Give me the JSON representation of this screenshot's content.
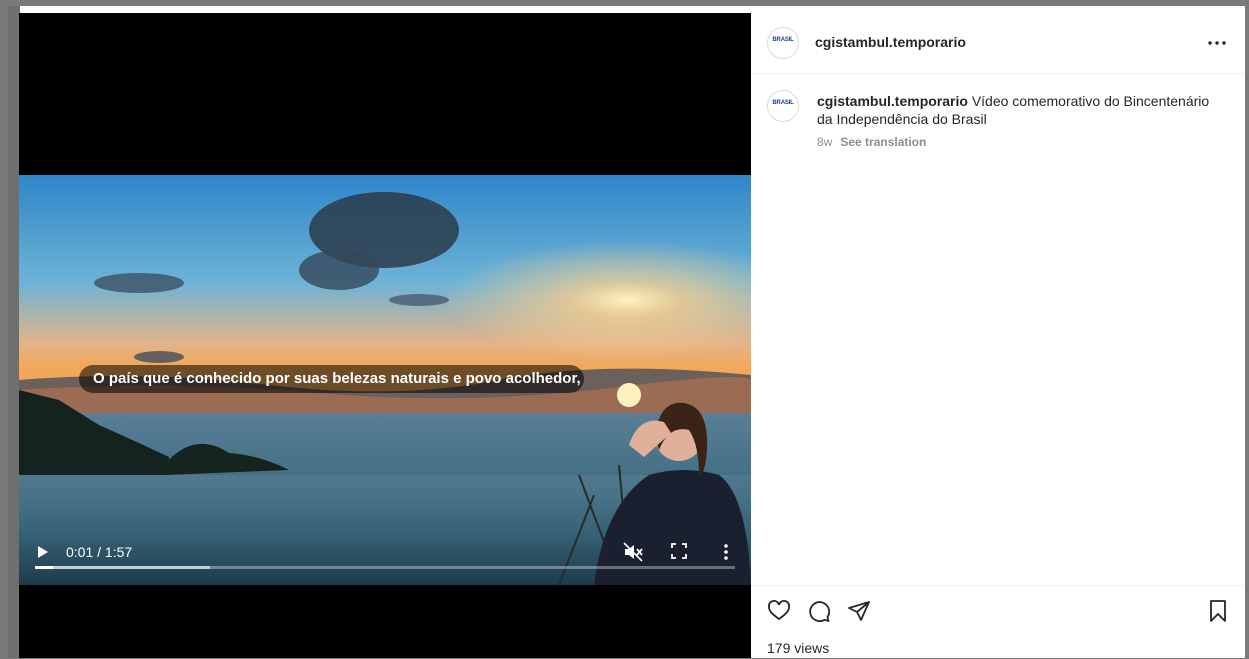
{
  "video": {
    "subtitle": "O país que é conhecido por suas belezas naturais e povo acolhedor,",
    "time": "0:01 / 1:57",
    "progress": 0.025,
    "buffered": 0.25
  },
  "post": {
    "author": "cgistambul.temporario",
    "avatar_text": "BRASIL",
    "caption_user": "cgistambul.temporario",
    "caption_text": "Vídeo comemorativo do Bincentenário da Independência do Brasil",
    "age": "8w",
    "see_translation": "See translation",
    "views": "179 views"
  },
  "colors": {
    "accent": "#262626",
    "muted": "#8e8e8e",
    "border": "#efefef"
  },
  "icons": [
    "play-icon",
    "mute-icon",
    "fullscreen-icon",
    "more-vertical-icon",
    "more-horizontal-icon",
    "heart-icon",
    "comment-icon",
    "share-icon",
    "bookmark-icon"
  ]
}
